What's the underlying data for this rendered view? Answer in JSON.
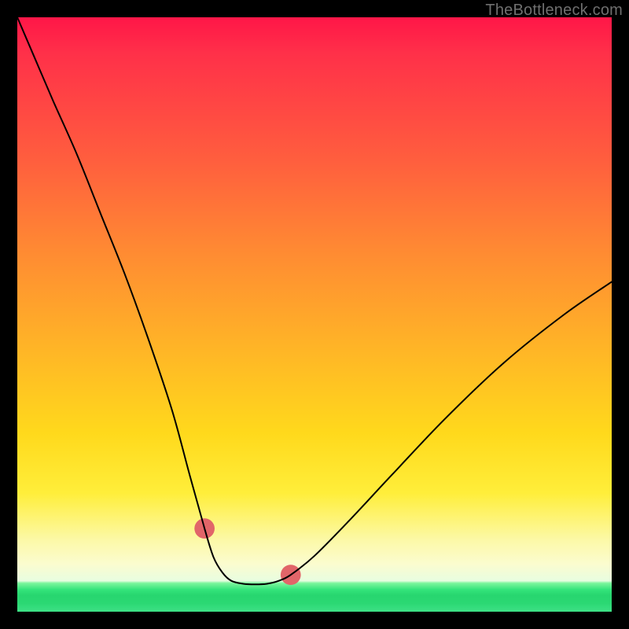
{
  "watermark": {
    "text": "TheBottleneck.com"
  },
  "chart_data": {
    "type": "line",
    "title": "",
    "xlabel": "",
    "ylabel": "",
    "xlim": [
      0,
      100
    ],
    "ylim": [
      0,
      100
    ],
    "grid": false,
    "legend": false,
    "background_gradient": {
      "direction": "vertical",
      "stops": [
        {
          "pos": 0.0,
          "color": "#ff1648"
        },
        {
          "pos": 0.06,
          "color": "#ff3049"
        },
        {
          "pos": 0.24,
          "color": "#ff5e3e"
        },
        {
          "pos": 0.4,
          "color": "#ff8c32"
        },
        {
          "pos": 0.55,
          "color": "#ffb327"
        },
        {
          "pos": 0.7,
          "color": "#ffd91c"
        },
        {
          "pos": 0.8,
          "color": "#ffee3a"
        },
        {
          "pos": 0.88,
          "color": "#fcf9a8"
        },
        {
          "pos": 0.92,
          "color": "#fbfccf"
        },
        {
          "pos": 0.948,
          "color": "#e8fde0"
        },
        {
          "pos": 0.952,
          "color": "#7cf59c"
        },
        {
          "pos": 0.963,
          "color": "#34e47b"
        },
        {
          "pos": 0.972,
          "color": "#27d66f"
        },
        {
          "pos": 0.986,
          "color": "#2bd873"
        },
        {
          "pos": 1.0,
          "color": "#3ee187"
        }
      ]
    },
    "series": [
      {
        "name": "black-curve",
        "color": "#000000",
        "stroke_width": 2,
        "x": [
          0,
          3,
          6,
          10,
          14,
          18,
          22,
          26,
          29,
          31.5,
          33,
          34.5,
          36,
          38,
          40,
          42,
          44,
          46,
          50,
          56,
          63,
          72,
          82,
          92,
          100
        ],
        "y": [
          100,
          93,
          86,
          77,
          67,
          57,
          46,
          34,
          23,
          14,
          9.2,
          6.6,
          5.2,
          4.7,
          4.6,
          4.7,
          5.2,
          6.2,
          9.4,
          15.5,
          23,
          32.5,
          42,
          50,
          55.5
        ]
      },
      {
        "name": "pink-valley-highlight",
        "color": "#e16569",
        "stroke_width": 10,
        "linecap": "round",
        "x": [
          31.5,
          33,
          34.5,
          36,
          38,
          40,
          42,
          44,
          46
        ],
        "y": [
          14,
          9.2,
          6.6,
          5.2,
          4.7,
          4.6,
          4.7,
          5.2,
          6.2
        ],
        "endpoint_markers": true,
        "marker_radius": 1.7
      }
    ]
  }
}
